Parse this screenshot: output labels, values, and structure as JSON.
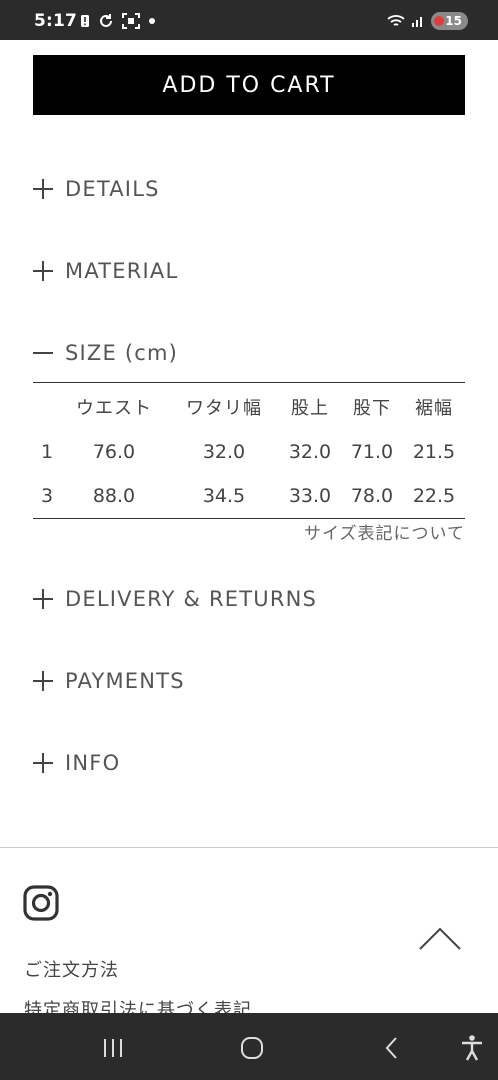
{
  "status_bar": {
    "time": "5:17",
    "battery": "15",
    "icons": [
      "sim-alert-icon",
      "sync-icon",
      "screenshot-icon",
      "dot-icon",
      "wifi-icon",
      "signal-icon",
      "battery-icon"
    ]
  },
  "product": {
    "add_to_cart_label": "ADD TO CART"
  },
  "accordion": {
    "details": "DETAILS",
    "material": "MATERIAL",
    "size": "SIZE (cm)",
    "delivery": "DELIVERY & RETURNS",
    "payments": "PAYMENTS",
    "info": "INFO"
  },
  "size_table": {
    "headers": [
      "",
      "ウエスト",
      "ワタリ幅",
      "股上",
      "股下",
      "裾幅"
    ],
    "rows": [
      [
        "1",
        "76.0",
        "32.0",
        "32.0",
        "71.0",
        "21.5"
      ],
      [
        "3",
        "88.0",
        "34.5",
        "33.0",
        "78.0",
        "22.5"
      ]
    ],
    "note": "サイズ表記について"
  },
  "footer": {
    "links": [
      "ご注文方法",
      "特定商取引法に基づく表記"
    ],
    "icons": [
      "instagram-icon",
      "chevron-up-icon"
    ]
  },
  "nav_bar": {
    "icons": [
      "recent-apps-icon",
      "home-icon",
      "back-icon",
      "accessibility-icon"
    ]
  }
}
